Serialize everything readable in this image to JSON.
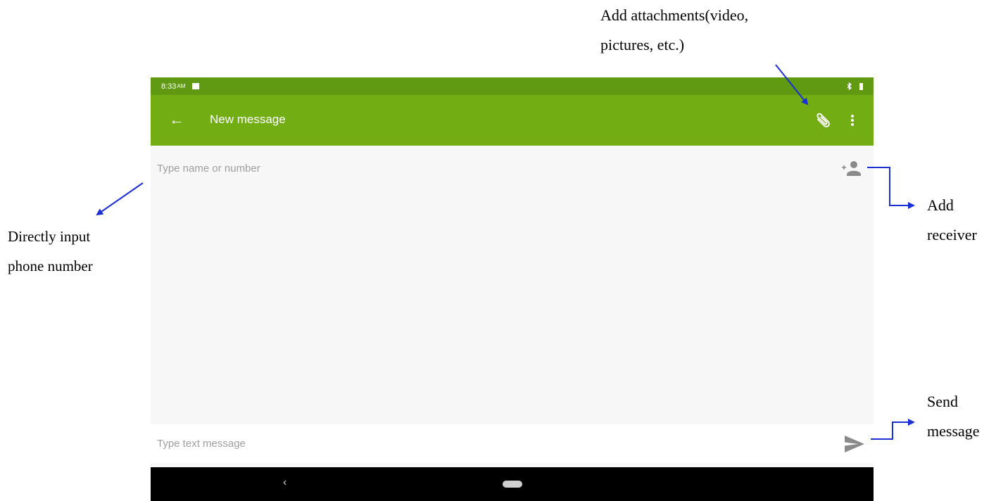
{
  "status": {
    "time": "8:33",
    "ampm": "AM"
  },
  "toolbar": {
    "back_glyph": "←",
    "title": "New message",
    "more_glyph": "⋮"
  },
  "recipient": {
    "placeholder": "Type name or number"
  },
  "compose": {
    "placeholder": "Type text message"
  },
  "navbar": {
    "back_glyph": "‹"
  },
  "annotations": {
    "attachments_line1": "Add  attachments(video,",
    "attachments_line2": "pictures, etc.)",
    "direct_line1": "Directly  input",
    "direct_line2": "phone number",
    "receiver_line1": "Add",
    "receiver_line2": "receiver",
    "send_line1": "Send",
    "send_line2": "message"
  },
  "colors": {
    "toolbar": "#72ad14",
    "statusbar": "#5f9a12",
    "arrow": "#1a2fd6",
    "icon_gray": "#8a8a8a"
  }
}
